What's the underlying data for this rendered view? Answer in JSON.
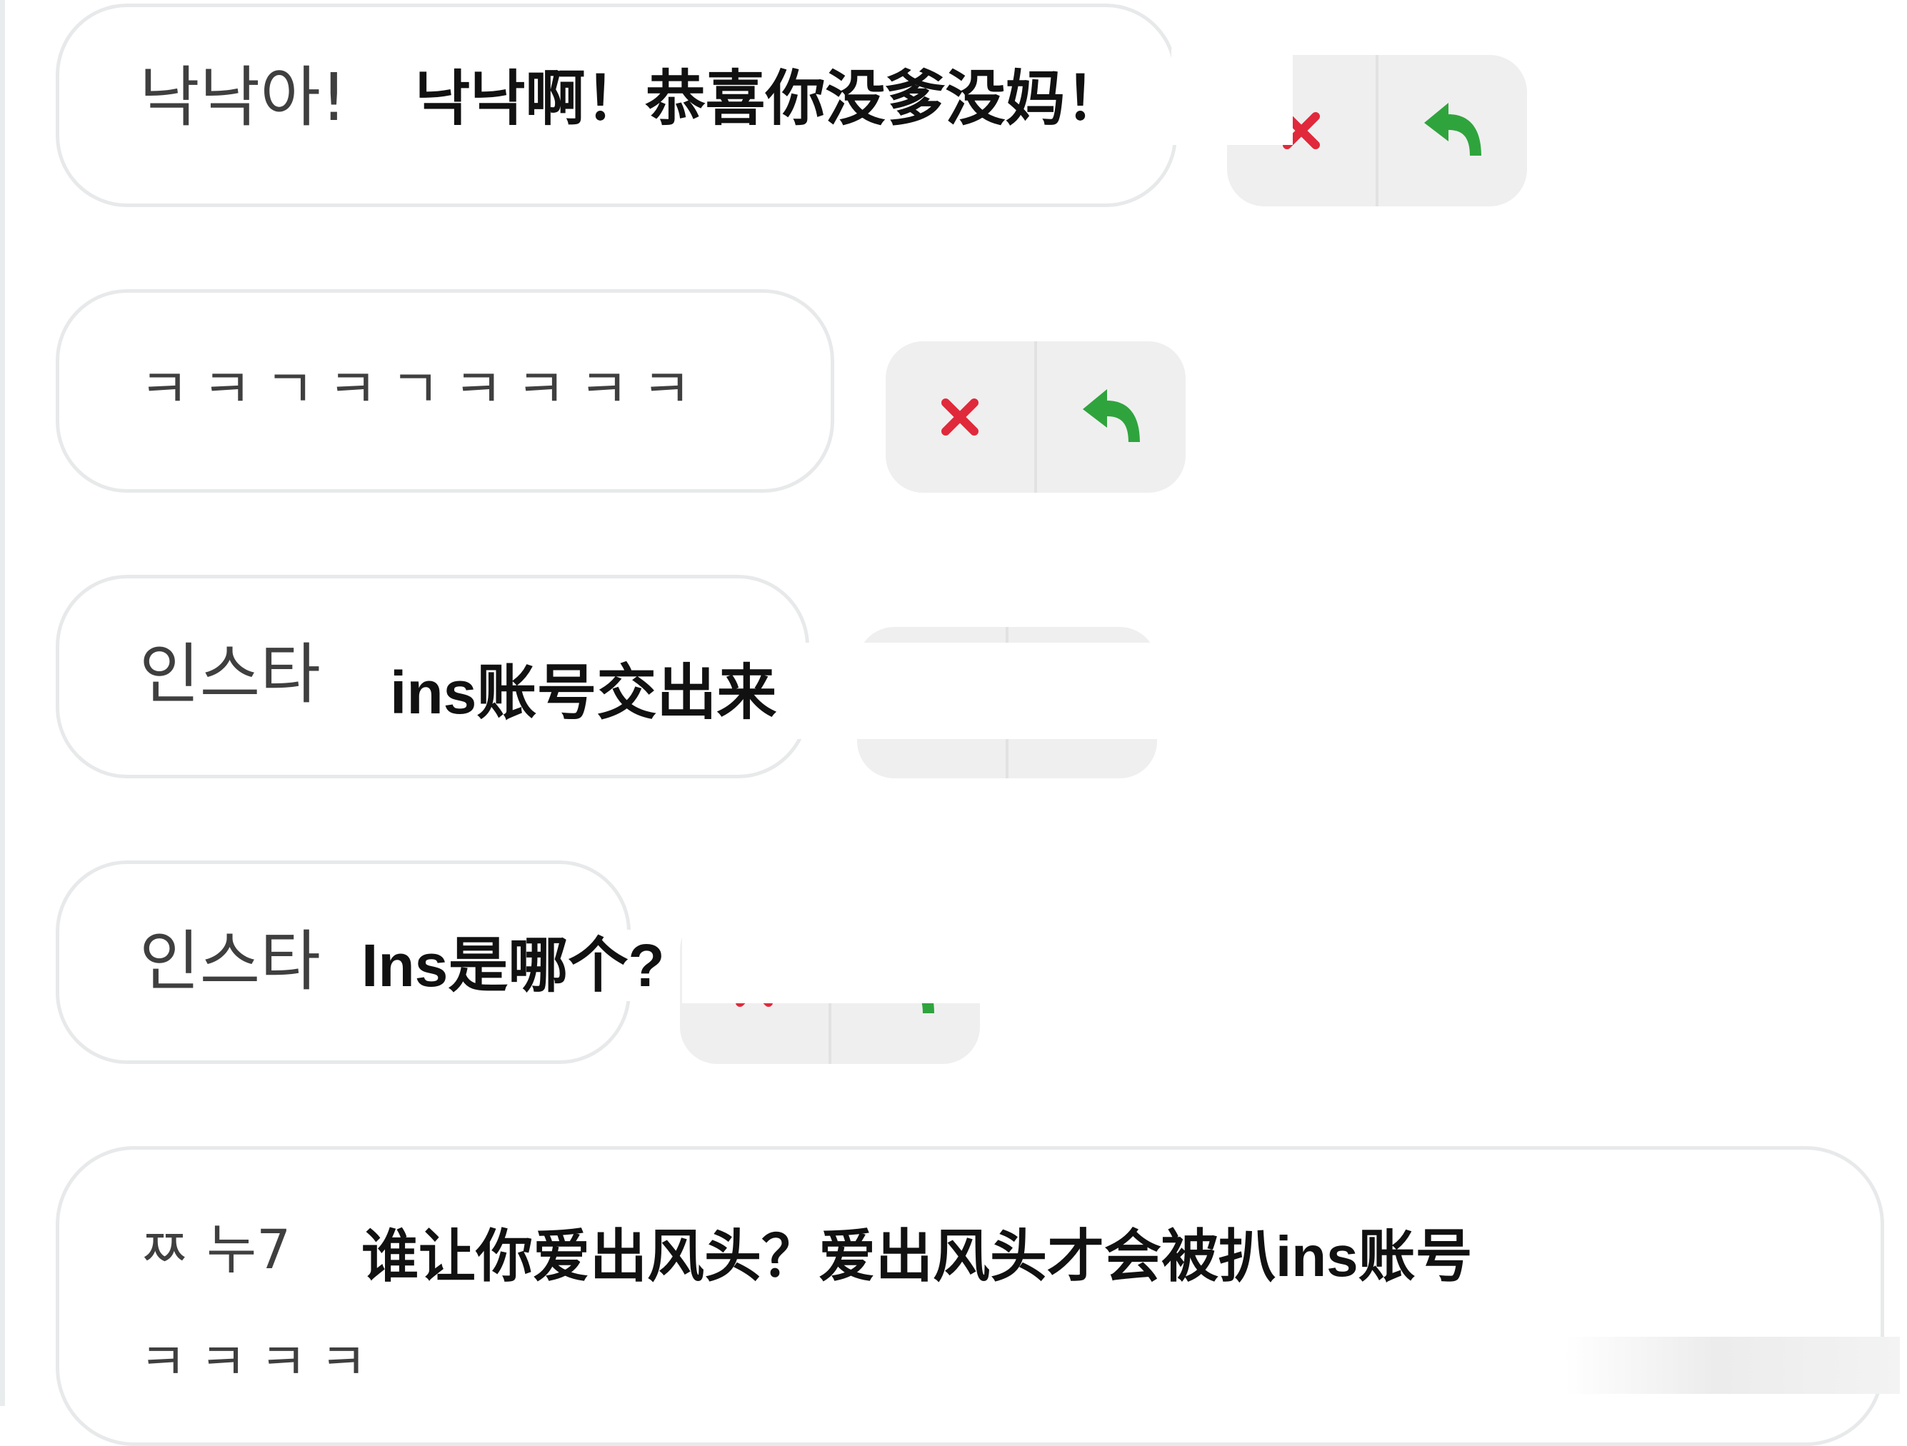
{
  "colors": {
    "delete": "#e0293b",
    "reply": "#2fa43d",
    "bubble_border": "#e7e9ea",
    "action_bg": "#efefef"
  },
  "messages": [
    {
      "original": "낙낙아!",
      "translation": "낙낙啊！恭喜你没爹没妈！",
      "actions": [
        "close-icon",
        "reply-icon"
      ]
    },
    {
      "original": "ㅋㅋㄱㅋㄱㅋㅋㅋㅋ",
      "translation": "",
      "actions": [
        "close-icon",
        "reply-icon"
      ]
    },
    {
      "original": "인스타",
      "translation": "ins账号交出来",
      "actions": [
        "close-icon",
        "reply-icon"
      ]
    },
    {
      "original": "인스타",
      "translation": "Ins是哪个?",
      "actions": [
        "close-icon",
        "reply-icon"
      ]
    },
    {
      "original": "ㅉ 누7",
      "translation": "谁让你爱出风头？爱出风头才会被扒ins账号",
      "original_line2": "ㅋㅋㅋㅋ"
    }
  ]
}
